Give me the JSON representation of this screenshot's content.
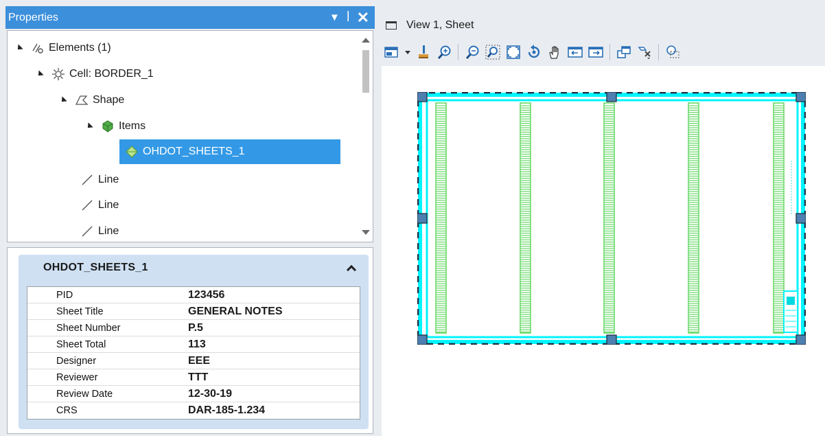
{
  "properties_panel": {
    "title": "Properties",
    "tree": {
      "elements_label": "Elements (1)",
      "cell_label": "Cell: BORDER_1",
      "shape_label": "Shape",
      "items_label": "Items",
      "selected_label": "OHDOT_SHEETS_1",
      "line_labels": [
        "Line",
        "Line",
        "Line"
      ]
    },
    "details": {
      "header": "OHDOT_SHEETS_1",
      "rows": [
        {
          "key": "PID",
          "value": "123456"
        },
        {
          "key": "Sheet Title",
          "value": "GENERAL NOTES"
        },
        {
          "key": "Sheet Number",
          "value": "P.5"
        },
        {
          "key": "Sheet Total",
          "value": "113"
        },
        {
          "key": "Designer",
          "value": "EEE"
        },
        {
          "key": "Reviewer",
          "value": "TTT"
        },
        {
          "key": "Review Date",
          "value": "12-30-19"
        },
        {
          "key": "CRS",
          "value": "DAR-185-1.234"
        }
      ]
    }
  },
  "view": {
    "title": "View 1, Sheet",
    "toolbar_icons": [
      "view-attributes-icon",
      "dropdown-arrow-icon",
      "update-view-icon",
      "zoom-in-icon",
      "zoom-out-icon",
      "window-area-icon",
      "fit-view-icon",
      "rotate-view-icon",
      "pan-view-icon",
      "previous-view-icon",
      "next-view-icon",
      "copy-view-icon",
      "view-display-icon",
      "clip-volume-icon"
    ]
  },
  "colors": {
    "title_bar": "#3c8fdb",
    "selection": "#3399e6",
    "sheet_border": "#00f5ff",
    "column_green": "#33cc33",
    "handle": "#4d7fb0"
  }
}
